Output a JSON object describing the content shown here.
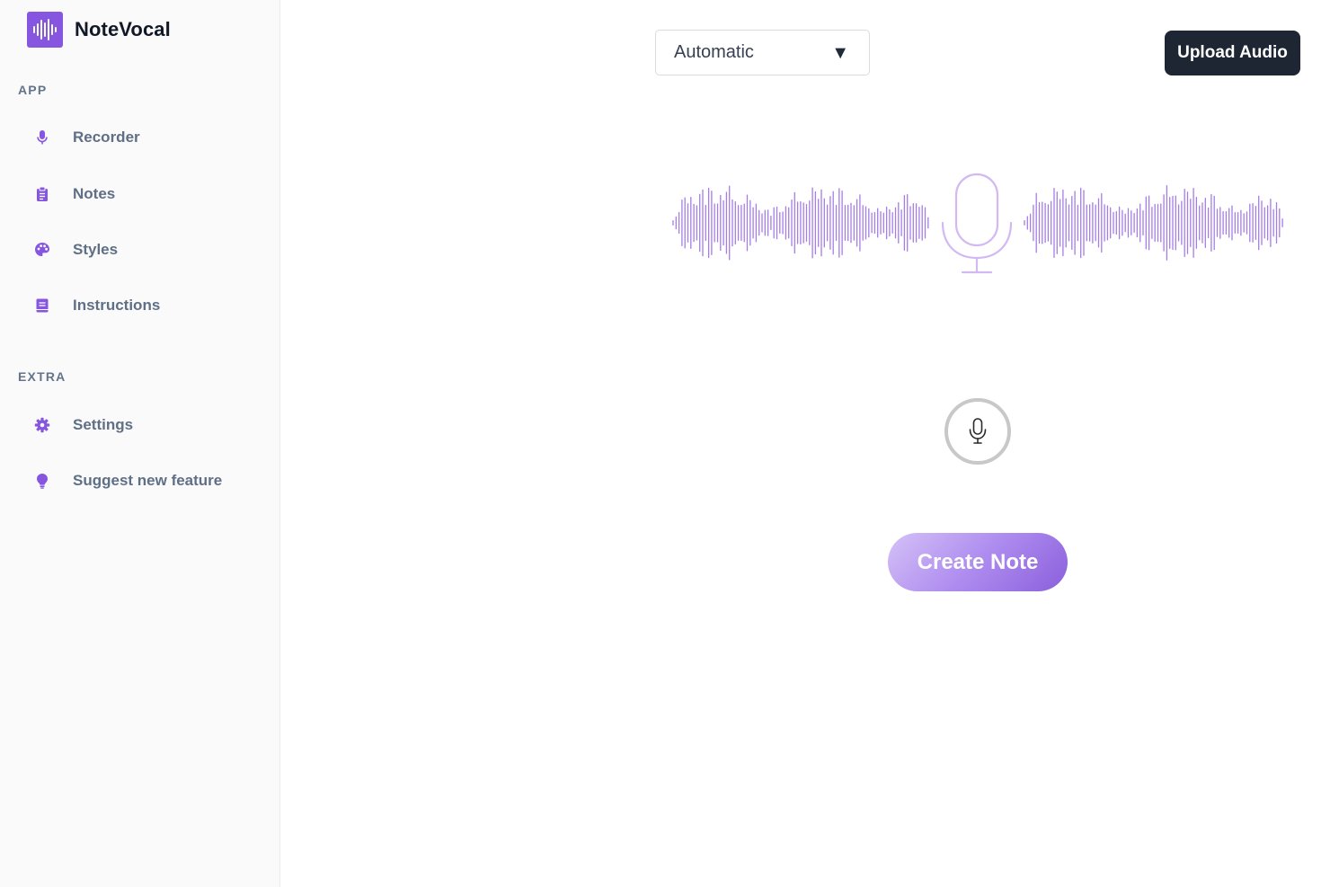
{
  "brand": {
    "name": "NoteVocal",
    "logo_icon": "waveform-icon"
  },
  "sidebar": {
    "sections": [
      {
        "label": "APP",
        "items": [
          {
            "label": "Recorder",
            "icon": "microphone-icon"
          },
          {
            "label": "Notes",
            "icon": "clipboard-icon"
          },
          {
            "label": "Styles",
            "icon": "palette-icon"
          },
          {
            "label": "Instructions",
            "icon": "book-icon"
          }
        ]
      },
      {
        "label": "EXTRA",
        "items": [
          {
            "label": "Settings",
            "icon": "gear-icon"
          },
          {
            "label": "Suggest new feature",
            "icon": "lightbulb-icon"
          }
        ]
      }
    ]
  },
  "main": {
    "mode_select": {
      "value": "Automatic",
      "arrow": "▼"
    },
    "upload_label": "Upload Audio",
    "create_label": "Create Note",
    "record_icon": "microphone-icon"
  },
  "colors": {
    "accent": "#8656e0",
    "waveform": "#a47ee6",
    "upload_bg": "#1e2533",
    "sidebar_text": "#5f6f86"
  }
}
